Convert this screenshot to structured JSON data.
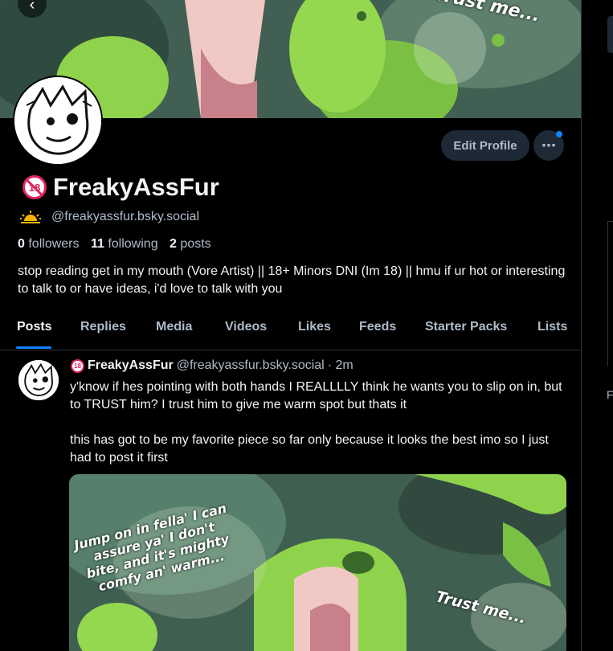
{
  "banner": {
    "speech_text": "Trust me..."
  },
  "actions": {
    "edit_profile": "Edit Profile",
    "more": "⋯"
  },
  "profile": {
    "age_badge": "18",
    "display_name": "FreakyAssFur",
    "handle": "@freakyassfur.bsky.social",
    "bio": "stop reading get in my mouth (Vore Artist) || 18+ Minors DNI (Im 18) || hmu if ur hot or interesting to talk to or have ideas, i'd love to talk with you"
  },
  "stats": {
    "followers_count": "0",
    "followers_label": "followers",
    "following_count": "11",
    "following_label": "following",
    "posts_count": "2",
    "posts_label": "posts"
  },
  "tabs": [
    "Posts",
    "Replies",
    "Media",
    "Videos",
    "Likes",
    "Feeds",
    "Starter Packs",
    "Lists"
  ],
  "post": {
    "author_name": "FreakyAssFur",
    "author_handle": "@freakyassfur.bsky.social",
    "time": "· 2m",
    "text_p1": "y'know if hes pointing with both hands I REALLLLY think he wants you to slip on in, but to TRUST him? I trust him to give me warm spot but thats it",
    "text_p2": "this has got to be my favorite piece so far only because it looks the best imo so I just had to post it first",
    "image_caption_left": "Jump on in fella' I can assure ya' I don't bite, and it's mighty comfy an' warm...",
    "image_caption_right": "Trust me..."
  },
  "right_panel": {
    "letter": "F"
  },
  "colors": {
    "accent": "#1083fe",
    "background": "#000000",
    "muted_text": "#aebbc9",
    "badge_red": "#e0245e"
  }
}
